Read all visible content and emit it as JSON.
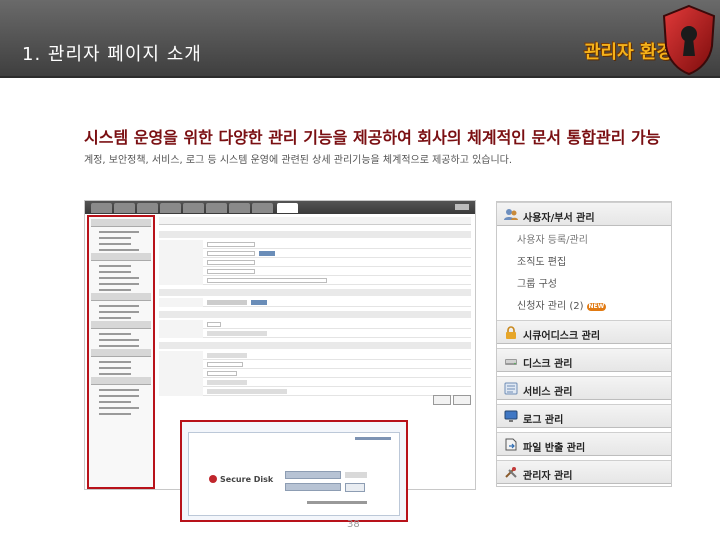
{
  "header": {
    "title": "1. 관리자 페이지 소개",
    "brand_label": "관리자 환경"
  },
  "headline": "시스템 운영을 위한 다양한 관리 기능을 제공하여 회사의 체계적인 문서 통합관리 가능",
  "subline": "계정, 보안정책, 서비스, 로그 등 시스템 운영에 관련된 상세 관리기능을 체계적으로 제공하고 있습니다.",
  "login_preview": {
    "logo_text": "Secure Disk"
  },
  "menu": {
    "user_section": {
      "label": "사용자/부서 관리",
      "items": [
        {
          "label": "사용자 등록/관리"
        },
        {
          "label": "조직도 편집"
        },
        {
          "label": "그룹 구성"
        },
        {
          "label": "신청자 관리 (2)",
          "badge": "NEW"
        }
      ]
    },
    "sections": [
      {
        "label": "시큐어디스크 관리",
        "icon": "lock-icon"
      },
      {
        "label": "디스크 관리",
        "icon": "disk-icon"
      },
      {
        "label": "서비스 관리",
        "icon": "service-icon"
      },
      {
        "label": "로그 관리",
        "icon": "monitor-icon"
      },
      {
        "label": "파일 반출 관리",
        "icon": "file-export-icon"
      },
      {
        "label": "관리자 관리",
        "icon": "tools-icon"
      }
    ]
  },
  "page_number": "38",
  "colors": {
    "accent_red": "#b8121a",
    "headline_red": "#7a0f12",
    "header_gray": "#4f4f4f",
    "badge_orange": "#e17a12"
  }
}
